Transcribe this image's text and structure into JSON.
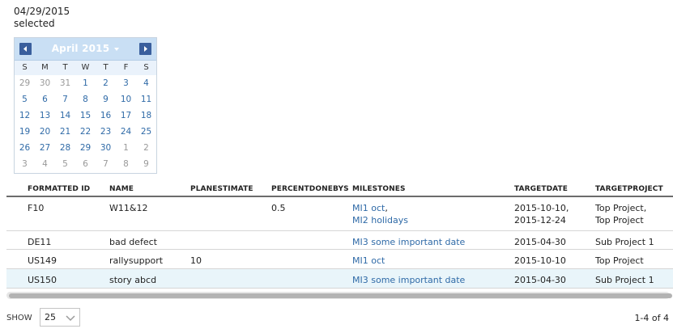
{
  "selection": {
    "date": "04/29/2015",
    "status": "selected"
  },
  "calendar": {
    "month_label": "April 2015",
    "days_of_week": [
      "S",
      "M",
      "T",
      "W",
      "T",
      "F",
      "S"
    ],
    "weeks": [
      [
        {
          "d": "29",
          "o": true
        },
        {
          "d": "30",
          "o": true
        },
        {
          "d": "31",
          "o": true
        },
        {
          "d": "1",
          "o": false
        },
        {
          "d": "2",
          "o": false
        },
        {
          "d": "3",
          "o": false
        },
        {
          "d": "4",
          "o": false
        }
      ],
      [
        {
          "d": "5",
          "o": false
        },
        {
          "d": "6",
          "o": false
        },
        {
          "d": "7",
          "o": false
        },
        {
          "d": "8",
          "o": false
        },
        {
          "d": "9",
          "o": false
        },
        {
          "d": "10",
          "o": false
        },
        {
          "d": "11",
          "o": false
        }
      ],
      [
        {
          "d": "12",
          "o": false
        },
        {
          "d": "13",
          "o": false
        },
        {
          "d": "14",
          "o": false
        },
        {
          "d": "15",
          "o": false
        },
        {
          "d": "16",
          "o": false
        },
        {
          "d": "17",
          "o": false
        },
        {
          "d": "18",
          "o": false
        }
      ],
      [
        {
          "d": "19",
          "o": false
        },
        {
          "d": "20",
          "o": false
        },
        {
          "d": "21",
          "o": false
        },
        {
          "d": "22",
          "o": false
        },
        {
          "d": "23",
          "o": false
        },
        {
          "d": "24",
          "o": false
        },
        {
          "d": "25",
          "o": false
        }
      ],
      [
        {
          "d": "26",
          "o": false
        },
        {
          "d": "27",
          "o": false
        },
        {
          "d": "28",
          "o": false
        },
        {
          "d": "29",
          "o": false
        },
        {
          "d": "30",
          "o": false
        },
        {
          "d": "1",
          "o": true
        },
        {
          "d": "2",
          "o": true
        }
      ],
      [
        {
          "d": "3",
          "o": true
        },
        {
          "d": "4",
          "o": true
        },
        {
          "d": "5",
          "o": true
        },
        {
          "d": "6",
          "o": true
        },
        {
          "d": "7",
          "o": true
        },
        {
          "d": "8",
          "o": true
        },
        {
          "d": "9",
          "o": true
        }
      ]
    ]
  },
  "grid": {
    "columns": [
      "FORMATTED ID",
      "NAME",
      "PLANESTIMATE",
      "PERCENTDONEBYSTORYCOUNT",
      "MILESTONES",
      "TARGETDATE",
      "TARGETPROJECT"
    ],
    "rows": [
      {
        "id": "F10",
        "name": "W11&12",
        "plan": "",
        "pct": "0.5",
        "milestones": [
          "MI1 oct",
          "MI2 holidays"
        ],
        "dates": [
          "2015-10-10,",
          "2015-12-24"
        ],
        "projects": [
          "Top Project,",
          "Top Project"
        ]
      },
      {
        "id": "DE11",
        "name": "bad defect",
        "plan": "",
        "pct": "",
        "milestones": [
          "MI3 some important date"
        ],
        "dates": [
          "2015-04-30"
        ],
        "projects": [
          "Sub Project 1"
        ]
      },
      {
        "id": "US149",
        "name": "rallysupport",
        "plan": "10",
        "pct": "",
        "milestones": [
          "MI1 oct"
        ],
        "dates": [
          "2015-10-10"
        ],
        "projects": [
          "Top Project"
        ]
      },
      {
        "id": "US150",
        "name": "story abcd",
        "plan": "",
        "pct": "",
        "milestones": [
          "MI3 some important date"
        ],
        "dates": [
          "2015-04-30"
        ],
        "projects": [
          "Sub Project 1"
        ]
      }
    ],
    "selected_row": 3
  },
  "footer": {
    "show_label": "SHOW",
    "page_size": "25",
    "pager_text": "1-4 of 4"
  }
}
